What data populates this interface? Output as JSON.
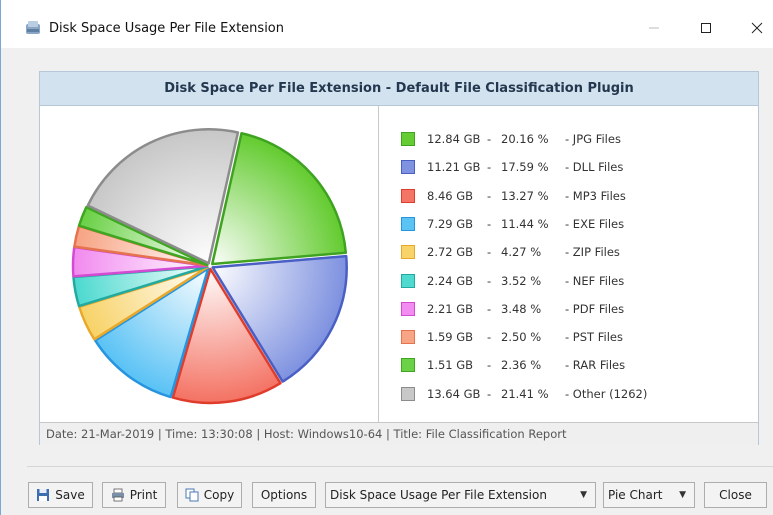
{
  "window": {
    "title": "Disk Space Usage Per File Extension",
    "controls": {
      "minimize": "—",
      "maximize": "☐",
      "close": "✕"
    }
  },
  "report": {
    "title": "Disk Space Per File Extension - Default File Classification Plugin",
    "footer": "Date: 21-Mar-2019 | Time: 13:30:08 | Host: Windows10-64 | Title: File Classification Report"
  },
  "legend": [
    {
      "size": "12.84 GB",
      "dash": "-",
      "pct": "20.16 %",
      "name": "-  JPG Files"
    },
    {
      "size": "11.21 GB",
      "dash": "-",
      "pct": "17.59 %",
      "name": "-  DLL Files"
    },
    {
      "size": "8.46 GB",
      "dash": "-",
      "pct": "13.27 %",
      "name": "-  MP3 Files"
    },
    {
      "size": "7.29 GB",
      "dash": "-",
      "pct": "11.44 %",
      "name": "-  EXE Files"
    },
    {
      "size": "2.72 GB",
      "dash": "-",
      "pct": "4.27 %",
      "name": "-  ZIP Files"
    },
    {
      "size": "2.24 GB",
      "dash": "-",
      "pct": "3.52 %",
      "name": "-  NEF Files"
    },
    {
      "size": "2.21 GB",
      "dash": "-",
      "pct": "3.48 %",
      "name": "-  PDF Files"
    },
    {
      "size": "1.59 GB",
      "dash": "-",
      "pct": "2.50 %",
      "name": "-  PST Files"
    },
    {
      "size": "1.51 GB",
      "dash": "-",
      "pct": "2.36 %",
      "name": "-  RAR Files"
    },
    {
      "size": "13.64 GB",
      "dash": "-",
      "pct": "21.41 %",
      "name": "-  Other (1262)"
    }
  ],
  "chart_data": {
    "type": "pie",
    "slices": [
      {
        "label": "JPG Files",
        "value": 20.16,
        "color": "#66cc33",
        "edge": "#3fa321"
      },
      {
        "label": "DLL Files",
        "value": 17.59,
        "color": "#8093e0",
        "edge": "#4a5fc4"
      },
      {
        "label": "MP3 Files",
        "value": 13.27,
        "color": "#f47566",
        "edge": "#e03c2c"
      },
      {
        "label": "EXE Files",
        "value": 11.44,
        "color": "#5cc3f5",
        "edge": "#2694de"
      },
      {
        "label": "ZIP Files",
        "value": 4.27,
        "color": "#f8d36a",
        "edge": "#e8a82a"
      },
      {
        "label": "NEF Files",
        "value": 3.52,
        "color": "#4fdad0",
        "edge": "#22aaa1"
      },
      {
        "label": "PDF Files",
        "value": 3.48,
        "color": "#f28cf0",
        "edge": "#d44ad2"
      },
      {
        "label": "PST Files",
        "value": 2.5,
        "color": "#f7a585",
        "edge": "#e5734e"
      },
      {
        "label": "RAR Files",
        "value": 2.36,
        "color": "#6bd147",
        "edge": "#3ea621"
      },
      {
        "label": "Other (1262)",
        "value": 21.41,
        "color": "#c8c8c8",
        "edge": "#8c8c8c"
      }
    ],
    "exploded": [
      "JPG Files",
      "DLL Files",
      "MP3 Files",
      "EXE Files",
      "ZIP Files",
      "NEF Files",
      "PDF Files",
      "PST Files",
      "RAR Files",
      "Other (1262)"
    ]
  },
  "toolbar": {
    "save": "Save",
    "print": "Print",
    "copy": "Copy",
    "options": "Options",
    "report_select": "Disk Space Usage Per File Extension",
    "chart_select": "Pie Chart",
    "close": "Close"
  }
}
